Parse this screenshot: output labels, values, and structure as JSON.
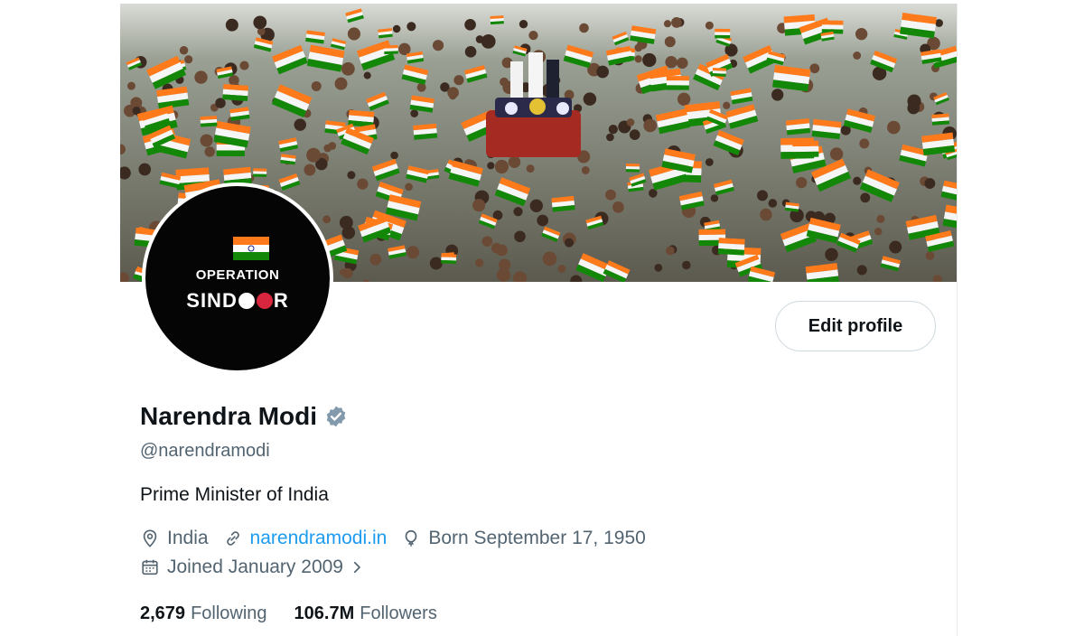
{
  "profile": {
    "name": "Narendra Modi",
    "handle": "@narendramodi",
    "bio": "Prime Minister of India",
    "location": "India",
    "website": "narendramodi.in",
    "born": "Born September 17, 1950",
    "joined": "Joined January 2009",
    "following_count": "2,679",
    "following_label": "Following",
    "followers_count": "106.7M",
    "followers_label": "Followers"
  },
  "avatar": {
    "line1": "OPERATION",
    "line2": "SIND",
    "line2_end": "R"
  },
  "actions": {
    "edit_profile": "Edit profile"
  },
  "icons": {
    "verified": "verified-badge-icon",
    "location": "location-pin-icon",
    "link": "link-icon",
    "birthday": "balloon-icon",
    "calendar": "calendar-icon",
    "chevron": "chevron-right-icon"
  },
  "colors": {
    "accent": "#1d9bf0",
    "saffron": "#ff7a1a",
    "green": "#138808",
    "text": "#0f1419",
    "muted": "#536471"
  }
}
